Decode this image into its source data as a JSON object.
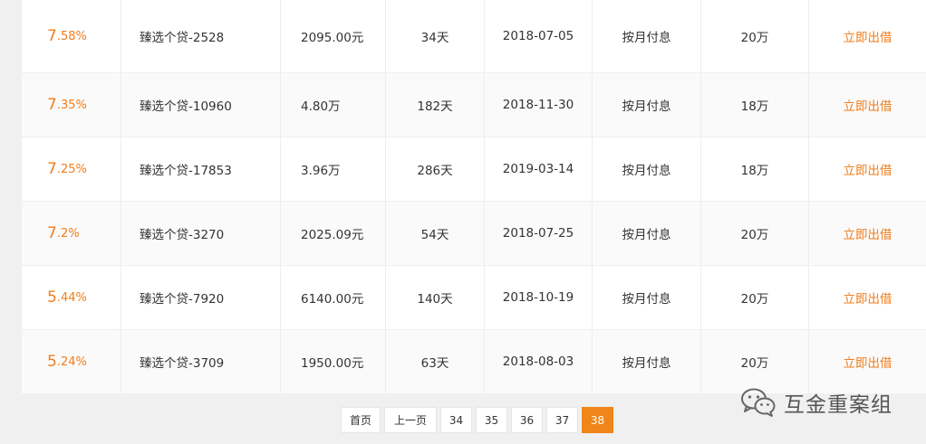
{
  "rows": [
    {
      "rate_int": "7",
      "rate_dec": ".58%",
      "name": "臻选个贷-2528",
      "amount": "2095.00元",
      "term": "34天",
      "date": "2018-07-05",
      "repay": "按月付息",
      "min": "20万",
      "action": "立即出借"
    },
    {
      "rate_int": "7",
      "rate_dec": ".35%",
      "name": "臻选个贷-10960",
      "amount": "4.80万",
      "term": "182天",
      "date": "2018-11-30",
      "repay": "按月付息",
      "min": "18万",
      "action": "立即出借"
    },
    {
      "rate_int": "7",
      "rate_dec": ".25%",
      "name": "臻选个贷-17853",
      "amount": "3.96万",
      "term": "286天",
      "date": "2019-03-14",
      "repay": "按月付息",
      "min": "18万",
      "action": "立即出借"
    },
    {
      "rate_int": "7",
      "rate_dec": ".2%",
      "name": "臻选个贷-3270",
      "amount": "2025.09元",
      "term": "54天",
      "date": "2018-07-25",
      "repay": "按月付息",
      "min": "20万",
      "action": "立即出借"
    },
    {
      "rate_int": "5",
      "rate_dec": ".44%",
      "name": "臻选个贷-7920",
      "amount": "6140.00元",
      "term": "140天",
      "date": "2018-10-19",
      "repay": "按月付息",
      "min": "20万",
      "action": "立即出借"
    },
    {
      "rate_int": "5",
      "rate_dec": ".24%",
      "name": "臻选个贷-3709",
      "amount": "1950.00元",
      "term": "63天",
      "date": "2018-08-03",
      "repay": "按月付息",
      "min": "20万",
      "action": "立即出借"
    }
  ],
  "pagination": {
    "first": "首页",
    "prev": "上一页",
    "pages": [
      "34",
      "35",
      "36",
      "37",
      "38"
    ],
    "current": "38"
  },
  "watermark": {
    "text": "互金重案组",
    "icon": "wechat-icon"
  },
  "colors": {
    "accent": "#f07d1a",
    "active_page": "#f08519"
  }
}
